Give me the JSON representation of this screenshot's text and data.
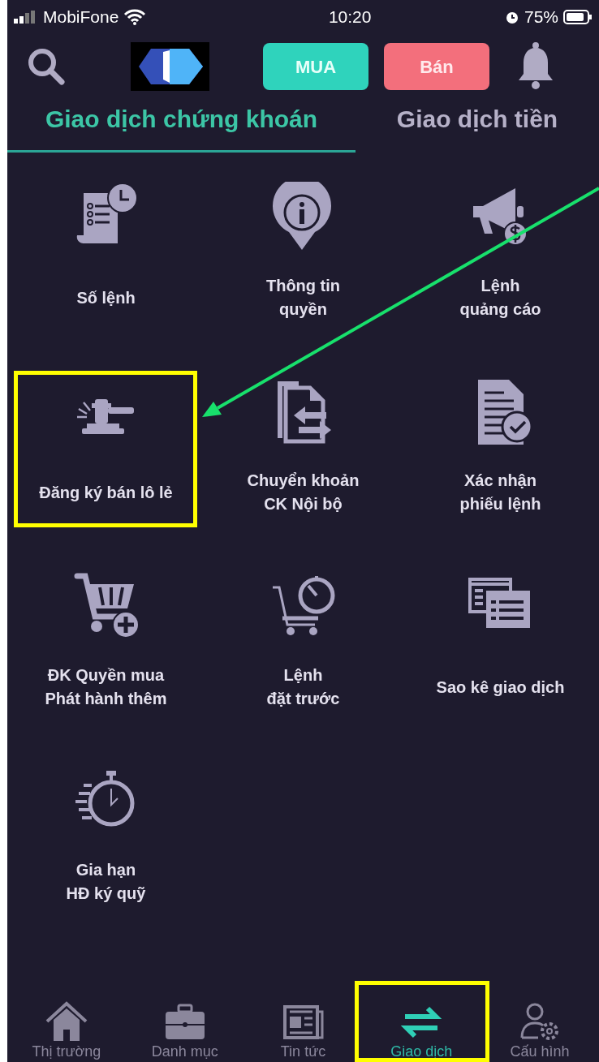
{
  "status_bar": {
    "carrier": "MobiFone",
    "time": "10:20",
    "battery": "75%"
  },
  "header": {
    "buy_button": "MUA",
    "sell_button": "Bán"
  },
  "tabs": [
    {
      "label": "Giao dịch chứng khoán",
      "selected": true
    },
    {
      "label": "Giao dịch tiền",
      "selected": false
    }
  ],
  "menu_items": [
    {
      "label": "Số lệnh"
    },
    {
      "label": "Thông tin\nquyền"
    },
    {
      "label": "Lệnh\nquảng cáo"
    },
    {
      "label": "Đăng ký bán lô lẻ",
      "highlighted": true
    },
    {
      "label": "Chuyển khoản\nCK Nội bộ"
    },
    {
      "label": "Xác nhận\nphiếu lệnh"
    },
    {
      "label": "ĐK Quyền mua\nPhát hành thêm"
    },
    {
      "label": "Lệnh\nđặt trước"
    },
    {
      "label": "Sao kê giao dịch"
    },
    {
      "label": "Gia hạn\nHĐ ký quỹ"
    }
  ],
  "bottom_nav": [
    {
      "label": "Thị trường",
      "selected": false
    },
    {
      "label": "Danh mục",
      "selected": false
    },
    {
      "label": "Tin tức",
      "selected": false
    },
    {
      "label": "Giao dịch",
      "selected": true,
      "highlighted": true
    },
    {
      "label": "Cấu hình",
      "selected": false
    }
  ]
}
